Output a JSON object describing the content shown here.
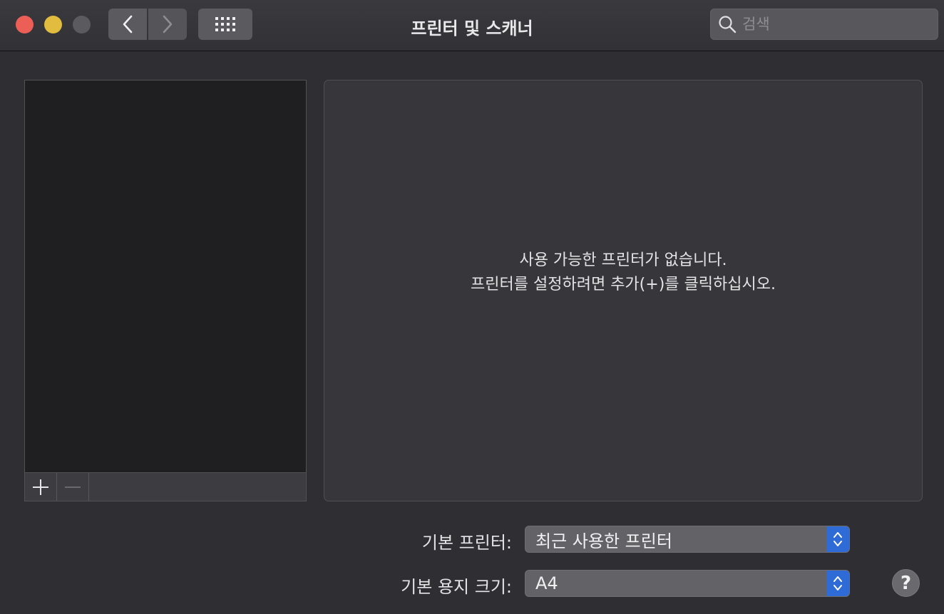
{
  "window": {
    "title": "프린터 및 스캐너"
  },
  "toolbar": {
    "search_placeholder": "검색"
  },
  "detail": {
    "empty_line1": "사용 가능한 프린터가 없습니다.",
    "empty_line2": "프린터를 설정하려면 추가(+)를 클릭하십시오."
  },
  "settings": {
    "default_printer_label": "기본 프린터:",
    "default_printer_value": "최근 사용한 프린터",
    "default_paper_label": "기본 용지 크기:",
    "default_paper_value": "A4"
  },
  "help": {
    "label": "?"
  },
  "colors": {
    "close": "#ec5f57",
    "minimize": "#e1bc3e",
    "accent": "#2f6bd6"
  },
  "icons": [
    "chevron-left-icon",
    "chevron-right-icon",
    "grid-icon",
    "search-icon",
    "plus-icon",
    "minus-icon",
    "chevron-updown-icon"
  ]
}
